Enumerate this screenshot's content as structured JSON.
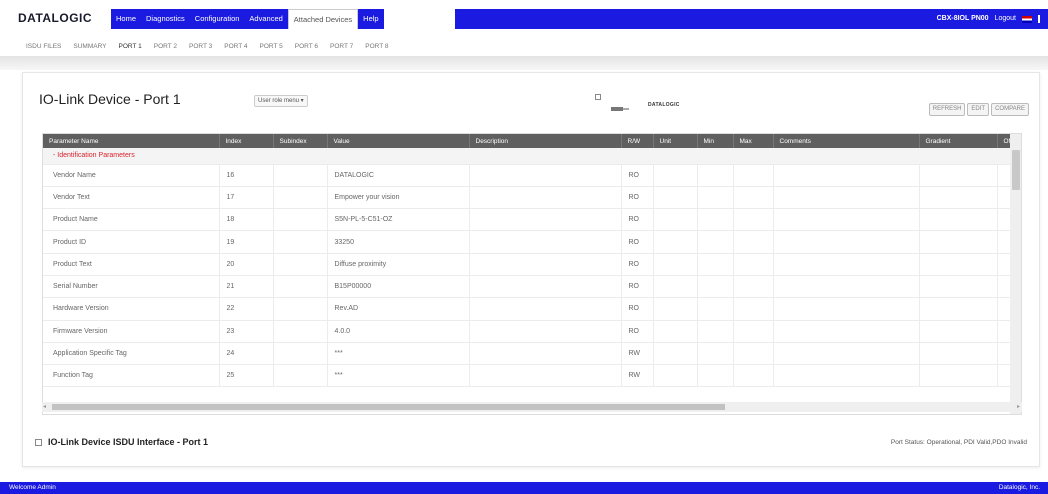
{
  "brand": {
    "logo_text": "DATALOGIC"
  },
  "nav": {
    "items": [
      {
        "label": "Home"
      },
      {
        "label": "Diagnostics"
      },
      {
        "label": "Configuration"
      },
      {
        "label": "Advanced"
      },
      {
        "label": "Attached Devices"
      },
      {
        "label": "Help"
      }
    ],
    "active_index": 4,
    "device_name": "CBX-8IOL PN00",
    "logout_label": "Logout"
  },
  "subnav": {
    "items": [
      "ISDU FILES",
      "SUMMARY",
      "PORT 1",
      "PORT 2",
      "PORT 3",
      "PORT 4",
      "PORT 5",
      "PORT 6",
      "PORT 7",
      "PORT 8"
    ],
    "active_index": 2
  },
  "device": {
    "title": "IO-Link Device - Port 1",
    "role_menu_label": "User role menu",
    "device_logo_text": "DATALOGIC",
    "buttons": [
      "REFRESH",
      "EDIT",
      "COMPARE"
    ]
  },
  "table": {
    "columns": [
      "Parameter Name",
      "Index",
      "Subindex",
      "Value",
      "Description",
      "R/W",
      "Unit",
      "Min",
      "Max",
      "Comments",
      "Gradient",
      "Of"
    ],
    "group_label": "- Identification Parameters",
    "rows": [
      {
        "name": "Vendor Name",
        "index": "16",
        "value": "DATALOGIC",
        "rw": "RO"
      },
      {
        "name": "Vendor Text",
        "index": "17",
        "value": "Empower your vision",
        "rw": "RO"
      },
      {
        "name": "Product Name",
        "index": "18",
        "value": "S5N-PL-5-C51-OZ",
        "rw": "RO"
      },
      {
        "name": "Product ID",
        "index": "19",
        "value": "33250",
        "rw": "RO"
      },
      {
        "name": "Product Text",
        "index": "20",
        "value": "Diffuse proximity",
        "rw": "RO"
      },
      {
        "name": "Serial Number",
        "index": "21",
        "value": "B15P00000",
        "rw": "RO"
      },
      {
        "name": "Hardware Version",
        "index": "22",
        "value": "Rev.AD",
        "rw": "RO"
      },
      {
        "name": "Firmware Version",
        "index": "23",
        "value": "4.0.0",
        "rw": "RO"
      },
      {
        "name": "Application Specific Tag",
        "index": "24",
        "value": "***",
        "rw": "RW"
      },
      {
        "name": "Function Tag",
        "index": "25",
        "value": "***",
        "rw": "RW"
      }
    ]
  },
  "isdu": {
    "title": "IO-Link Device ISDU Interface - Port 1",
    "port_status": "Port Status: Operational, PDI Valid,PDO Invalid"
  },
  "footer": {
    "welcome": "Welcome Admin",
    "company": "Datalogic, Inc."
  },
  "colors": {
    "nav_blue": "#1a1ae0",
    "header_gray": "#5f5f5f",
    "group_red": "#d9232d"
  }
}
